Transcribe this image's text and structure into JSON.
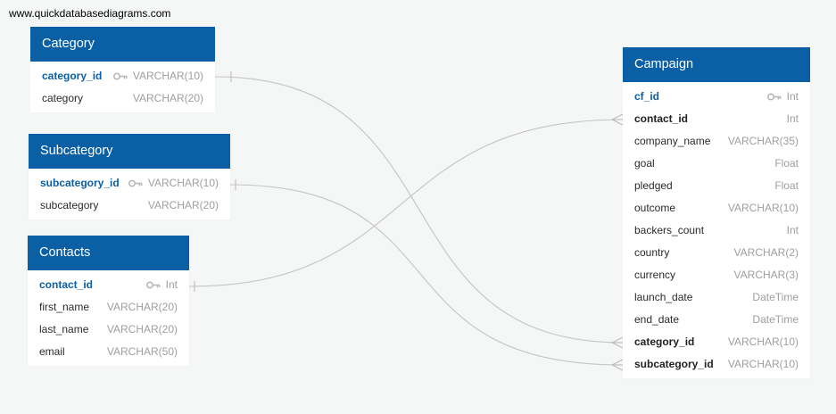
{
  "site_url": "www.quickdatabasediagrams.com",
  "colors": {
    "header": "#0b5fa5",
    "pk_text": "#0b5fa5",
    "type_text": "#9e9e9e",
    "connector": "#c4c4c4"
  },
  "tables": {
    "category": {
      "name": "Category",
      "fields": [
        {
          "name": "category_id",
          "type": "VARCHAR(10)",
          "key": "pk"
        },
        {
          "name": "category",
          "type": "VARCHAR(20)",
          "key": ""
        }
      ]
    },
    "subcategory": {
      "name": "Subcategory",
      "fields": [
        {
          "name": "subcategory_id",
          "type": "VARCHAR(10)",
          "key": "pk"
        },
        {
          "name": "subcategory",
          "type": "VARCHAR(20)",
          "key": ""
        }
      ]
    },
    "contacts": {
      "name": "Contacts",
      "fields": [
        {
          "name": "contact_id",
          "type": "Int",
          "key": "pk"
        },
        {
          "name": "first_name",
          "type": "VARCHAR(20)",
          "key": ""
        },
        {
          "name": "last_name",
          "type": "VARCHAR(20)",
          "key": ""
        },
        {
          "name": "email",
          "type": "VARCHAR(50)",
          "key": ""
        }
      ]
    },
    "campaign": {
      "name": "Campaign",
      "fields": [
        {
          "name": "cf_id",
          "type": "Int",
          "key": "pk"
        },
        {
          "name": "contact_id",
          "type": "Int",
          "key": "fk"
        },
        {
          "name": "company_name",
          "type": "VARCHAR(35)",
          "key": ""
        },
        {
          "name": "goal",
          "type": "Float",
          "key": ""
        },
        {
          "name": "pledged",
          "type": "Float",
          "key": ""
        },
        {
          "name": "outcome",
          "type": "VARCHAR(10)",
          "key": ""
        },
        {
          "name": "backers_count",
          "type": "Int",
          "key": ""
        },
        {
          "name": "country",
          "type": "VARCHAR(2)",
          "key": ""
        },
        {
          "name": "currency",
          "type": "VARCHAR(3)",
          "key": ""
        },
        {
          "name": "launch_date",
          "type": "DateTime",
          "key": ""
        },
        {
          "name": "end_date",
          "type": "DateTime",
          "key": ""
        },
        {
          "name": "category_id",
          "type": "VARCHAR(10)",
          "key": "fk"
        },
        {
          "name": "subcategory_id",
          "type": "VARCHAR(10)",
          "key": "fk"
        }
      ]
    }
  },
  "relationships": [
    {
      "from": "category.category_id",
      "to": "campaign.category_id"
    },
    {
      "from": "subcategory.subcategory_id",
      "to": "campaign.subcategory_id"
    },
    {
      "from": "contacts.contact_id",
      "to": "campaign.contact_id"
    }
  ]
}
